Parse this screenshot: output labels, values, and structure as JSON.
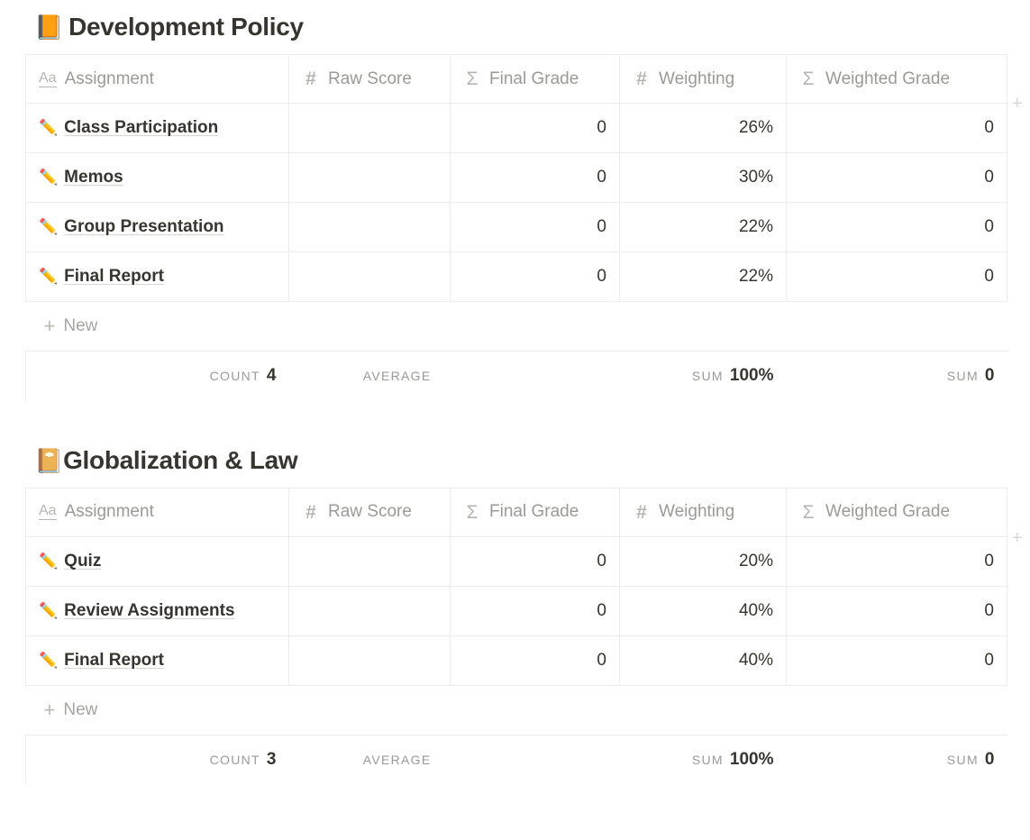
{
  "columns": [
    {
      "label": "Assignment",
      "type_icon": "title-aa-icon",
      "glyph": "Aa"
    },
    {
      "label": "Raw Score",
      "type_icon": "number-hash-icon",
      "glyph": "#"
    },
    {
      "label": "Final Grade",
      "type_icon": "formula-sigma-icon",
      "glyph": "Σ"
    },
    {
      "label": "Weighting",
      "type_icon": "number-hash-icon",
      "glyph": "#"
    },
    {
      "label": "Weighted Grade",
      "type_icon": "formula-sigma-icon",
      "glyph": "Σ"
    }
  ],
  "add_column_label": "+",
  "new_row_label": "New",
  "new_row_plus": "+",
  "row_emoji": "✏️",
  "tables": [
    {
      "title": "Development Policy",
      "emoji": "📙",
      "tight": false,
      "rows": [
        {
          "assignment": "Class Participation",
          "raw_score": "",
          "final_grade": "0",
          "weighting": "26%",
          "weighted_grade": "0"
        },
        {
          "assignment": "Memos",
          "raw_score": "",
          "final_grade": "0",
          "weighting": "30%",
          "weighted_grade": "0"
        },
        {
          "assignment": "Group Presentation",
          "raw_score": "",
          "final_grade": "0",
          "weighting": "22%",
          "weighted_grade": "0"
        },
        {
          "assignment": "Final Report",
          "raw_score": "",
          "final_grade": "0",
          "weighting": "22%",
          "weighted_grade": "0"
        }
      ],
      "footer": {
        "assignment": {
          "label": "COUNT",
          "value": "4"
        },
        "raw_score": {
          "label": "AVERAGE",
          "value": ""
        },
        "final_grade": {
          "label": "",
          "value": ""
        },
        "weighting": {
          "label": "SUM",
          "value": "100%"
        },
        "weighted_grade": {
          "label": "SUM",
          "value": "0"
        }
      }
    },
    {
      "title": "Globalization & Law",
      "emoji": "📔",
      "tight": true,
      "rows": [
        {
          "assignment": "Quiz",
          "raw_score": "",
          "final_grade": "0",
          "weighting": "20%",
          "weighted_grade": "0"
        },
        {
          "assignment": "Review Assignments",
          "raw_score": "",
          "final_grade": "0",
          "weighting": "40%",
          "weighted_grade": "0"
        },
        {
          "assignment": "Final Report",
          "raw_score": "",
          "final_grade": "0",
          "weighting": "40%",
          "weighted_grade": "0"
        }
      ],
      "footer": {
        "assignment": {
          "label": "COUNT",
          "value": "3"
        },
        "raw_score": {
          "label": "AVERAGE",
          "value": ""
        },
        "final_grade": {
          "label": "",
          "value": ""
        },
        "weighting": {
          "label": "SUM",
          "value": "100%"
        },
        "weighted_grade": {
          "label": "SUM",
          "value": "0"
        }
      }
    }
  ],
  "colors": {
    "text": "#37352f",
    "muted": "#9b9a97",
    "border": "#ececeb",
    "background": "#ffffff"
  }
}
